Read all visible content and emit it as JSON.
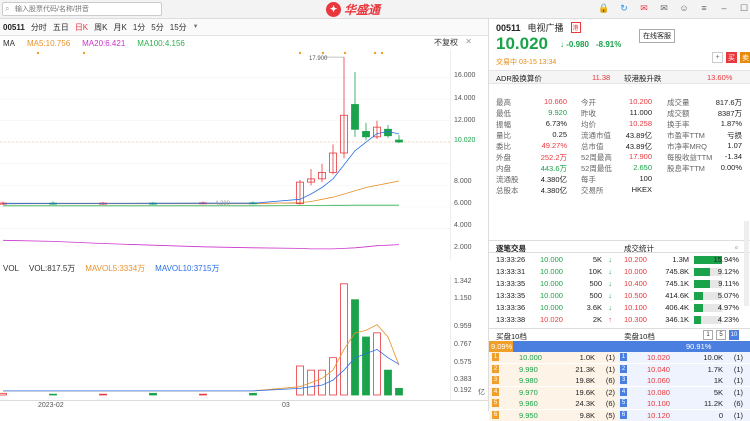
{
  "topbar": {
    "search_placeholder": "输入股票代码/名称/拼音",
    "logo_text": "华盛通",
    "icons": [
      "lock-icon",
      "refresh-icon",
      "message-icon",
      "mail-icon",
      "user-icon",
      "menu-icon",
      "minimize-icon",
      "maximize-icon",
      "close-icon"
    ]
  },
  "period_bar": {
    "code": "00511",
    "periods": [
      "分时",
      "五日",
      "日K",
      "周K",
      "月K",
      "1分",
      "5分",
      "15分"
    ],
    "active": "日K"
  },
  "ma_legend": {
    "label": "MA",
    "ma5": "MA5:10.756",
    "ma20": "MA20:6.421",
    "ma100": "MA100:4.156",
    "adjust": "不复权"
  },
  "price_axis": [
    "16.000",
    "14.000",
    "12.000",
    "10.020",
    "8.000",
    "6.000",
    "4.000",
    "2.000",
    "0.000"
  ],
  "high_marker": "17.900",
  "low_marker": "4.380",
  "vol_legend": {
    "label": "VOL",
    "vol": "VOL:817.5万",
    "mavol5": "MAVOL5:3334万",
    "mavol10": "MAVOL10:3715万"
  },
  "vol_axis": [
    "1.342",
    "1.150",
    "0.959",
    "0.767",
    "0.575",
    "0.383",
    "0.192"
  ],
  "vol_unit": "亿",
  "date_axis": [
    "2023-02",
    "03"
  ],
  "colors": {
    "up": "#e8383d",
    "down": "#1aa34a",
    "ma5": "#e8922c",
    "ma20": "#cc33cc",
    "ma100": "#2fae4e",
    "buy": "#f0a02a",
    "sell": "#4a7fe0"
  },
  "stock": {
    "code": "00511",
    "name": "电视广播",
    "price": "10.020",
    "change": "-0.980",
    "change_pct": "-8.91%",
    "service_button": "在线客服",
    "status": "交易中 03-15 13:34",
    "buy_btn": "买",
    "sell_btn": "卖",
    "more_btn": "更"
  },
  "adr": {
    "label": "ADR股换算价",
    "value": "11.38",
    "label2": "较港股升跌",
    "value2": "13.60%"
  },
  "quote": [
    [
      {
        "k": "最高",
        "v": "10.660",
        "c": "red"
      },
      {
        "k": "今开",
        "v": "10.200",
        "c": "red"
      },
      {
        "k": "成交量",
        "v": "817.6万",
        "c": "blk"
      }
    ],
    [
      {
        "k": "最低",
        "v": "9.920",
        "c": "grn"
      },
      {
        "k": "昨收",
        "v": "11.000",
        "c": "blk"
      },
      {
        "k": "成交额",
        "v": "8387万",
        "c": "blk"
      }
    ],
    [
      {
        "k": "振幅",
        "v": "6.73%",
        "c": "blk"
      },
      {
        "k": "均价",
        "v": "10.258",
        "c": "red"
      },
      {
        "k": "换手率",
        "v": "1.87%",
        "c": "blk"
      }
    ],
    [
      {
        "k": "量比",
        "v": "0.25",
        "c": "blk"
      },
      {
        "k": "流通市值",
        "v": "43.89亿",
        "c": "blk"
      },
      {
        "k": "市盈率TTM",
        "v": "亏损",
        "c": "blk"
      }
    ],
    [
      {
        "k": "委比",
        "v": "49.27%",
        "c": "red"
      },
      {
        "k": "总市值",
        "v": "43.89亿",
        "c": "blk"
      },
      {
        "k": "市净率MRQ",
        "v": "1.07",
        "c": "blk"
      }
    ],
    [
      {
        "k": "外盘",
        "v": "252.2万",
        "c": "red"
      },
      {
        "k": "52周最高",
        "v": "17.900",
        "c": "red"
      },
      {
        "k": "每股收益TTM",
        "v": "-1.34",
        "c": "blk"
      }
    ],
    [
      {
        "k": "内盘",
        "v": "443.6万",
        "c": "grn"
      },
      {
        "k": "52周最低",
        "v": "2.650",
        "c": "grn"
      },
      {
        "k": "股息率TTM",
        "v": "0.00%",
        "c": "blk"
      }
    ],
    [
      {
        "k": "流通股",
        "v": "4.380亿",
        "c": "blk"
      },
      {
        "k": "每手",
        "v": "100",
        "c": "blk"
      },
      {
        "k": "",
        "v": "",
        "c": "blk"
      }
    ],
    [
      {
        "k": "总股本",
        "v": "4.380亿",
        "c": "blk"
      },
      {
        "k": "交易所",
        "v": "HKEX",
        "c": "blk"
      },
      {
        "k": "",
        "v": "",
        "c": "blk"
      }
    ]
  ],
  "trades_tab": "逐笔交易",
  "stats_tab": "成交统计",
  "ticks": [
    {
      "t": "13:33:26",
      "p": "10.000",
      "v": "5K",
      "d": "down"
    },
    {
      "t": "13:33:31",
      "p": "10.000",
      "v": "10K",
      "d": "down"
    },
    {
      "t": "13:33:35",
      "p": "10.000",
      "v": "500",
      "d": "down"
    },
    {
      "t": "13:33:35",
      "p": "10.000",
      "v": "500",
      "d": "down"
    },
    {
      "t": "13:33:36",
      "p": "10.000",
      "v": "3.6K",
      "d": "down"
    },
    {
      "t": "13:33:38",
      "p": "10.020",
      "v": "2K",
      "d": "up"
    }
  ],
  "stats": [
    {
      "p": "10.200",
      "v": "1.3M",
      "pct": "15.94%",
      "f": 0.16
    },
    {
      "p": "10.000",
      "v": "745.8K",
      "pct": "9.12%",
      "f": 0.09
    },
    {
      "p": "10.400",
      "v": "745.1K",
      "pct": "9.11%",
      "f": 0.09
    },
    {
      "p": "10.500",
      "v": "414.6K",
      "pct": "5.07%",
      "f": 0.05
    },
    {
      "p": "10.100",
      "v": "406.4K",
      "pct": "4.97%",
      "f": 0.05
    },
    {
      "p": "10.300",
      "v": "346.1K",
      "pct": "4.23%",
      "f": 0.04
    }
  ],
  "orderbook": {
    "bid_tab": "买盘10档",
    "ask_tab": "卖盘10档",
    "pages": [
      "1",
      "5",
      "10"
    ],
    "bid_pct": "9.09%",
    "bid_frac": 0.0909,
    "ask_pct": "90.91%",
    "rows": [
      {
        "n": "1",
        "bp": "10.000",
        "bv": "1.0K",
        "bc": "(1)",
        "ap": "10.020",
        "av": "10.0K",
        "ac": "(1)"
      },
      {
        "n": "2",
        "bp": "9.990",
        "bv": "21.3K",
        "bc": "(1)",
        "ap": "10.040",
        "av": "1.7K",
        "ac": "(1)"
      },
      {
        "n": "3",
        "bp": "9.980",
        "bv": "19.8K",
        "bc": "(6)",
        "ap": "10.060",
        "av": "1K",
        "ac": "(1)"
      },
      {
        "n": "4",
        "bp": "9.970",
        "bv": "19.6K",
        "bc": "(2)",
        "ap": "10.080",
        "av": "5K",
        "ac": "(1)"
      },
      {
        "n": "5",
        "bp": "9.960",
        "bv": "24.3K",
        "bc": "(6)",
        "ap": "10.100",
        "av": "11.2K",
        "ac": "(6)"
      },
      {
        "n": "6",
        "bp": "9.950",
        "bv": "9.8K",
        "bc": "(5)",
        "ap": "10.120",
        "av": "0",
        "ac": "(1)"
      }
    ]
  },
  "chart_data": {
    "type": "candlestick",
    "ylim": [
      0,
      18
    ],
    "candles": [
      {
        "o": 4.3,
        "c": 4.35,
        "h": 4.5,
        "l": 4.2
      },
      {
        "o": 4.35,
        "c": 4.3,
        "h": 4.5,
        "l": 4.2
      },
      {
        "o": 4.3,
        "c": 4.35,
        "h": 4.45,
        "l": 4.2
      },
      {
        "o": 4.35,
        "c": 4.3,
        "h": 4.45,
        "l": 4.2
      },
      {
        "o": 4.3,
        "c": 4.38,
        "h": 4.5,
        "l": 4.25
      },
      {
        "o": 4.38,
        "c": 4.3,
        "h": 4.5,
        "l": 4.25
      },
      {
        "o": 4.3,
        "c": 6.3,
        "h": 6.5,
        "l": 4.2
      },
      {
        "o": 6.3,
        "c": 6.6,
        "h": 7.5,
        "l": 6.0
      },
      {
        "o": 6.6,
        "c": 7.2,
        "h": 8.0,
        "l": 6.3
      },
      {
        "o": 7.2,
        "c": 9.0,
        "h": 9.8,
        "l": 7.0
      },
      {
        "o": 9.0,
        "c": 12.5,
        "h": 17.9,
        "l": 8.5
      },
      {
        "o": 13.5,
        "c": 11.2,
        "h": 16.5,
        "l": 10.5
      },
      {
        "o": 11.0,
        "c": 10.5,
        "h": 11.8,
        "l": 10.2
      },
      {
        "o": 10.5,
        "c": 11.4,
        "h": 12.0,
        "l": 10.3
      },
      {
        "o": 11.2,
        "c": 10.6,
        "h": 11.6,
        "l": 10.4
      },
      {
        "o": 10.2,
        "c": 10.02,
        "h": 10.66,
        "l": 9.92
      }
    ],
    "ma5": [
      4.3,
      4.31,
      4.32,
      4.33,
      4.34,
      4.34,
      4.7,
      5.2,
      5.8,
      6.6,
      7.9,
      9.2,
      10.0,
      10.8,
      11.0,
      10.76
    ],
    "ma20": [
      0.9,
      0.8,
      0.6,
      0.45,
      0.3,
      0.2,
      0.15,
      0.1,
      0.1,
      0.1,
      0.15,
      0.2,
      0.3,
      0.4,
      0.45,
      0.5
    ],
    "mavolA": [
      4.3,
      4.3,
      4.3,
      4.3,
      4.3,
      4.3,
      4.4,
      4.5,
      4.7,
      4.9,
      5.2,
      5.5,
      5.8,
      6.0,
      6.2,
      6.4
    ],
    "ma100": [
      4.1,
      4.1,
      4.1,
      4.1,
      4.1,
      4.1,
      4.12,
      4.13,
      4.14,
      4.15,
      4.15,
      4.16,
      4.16,
      4.16,
      4.16,
      4.16
    ],
    "volume": [
      0.02,
      0.01,
      0.01,
      0.02,
      0.01,
      0.02,
      0.35,
      0.3,
      0.3,
      0.45,
      1.342,
      1.15,
      0.7,
      0.75,
      0.3,
      0.08
    ],
    "vol_up": [
      true,
      false,
      true,
      false,
      true,
      false,
      true,
      true,
      true,
      true,
      true,
      false,
      false,
      true,
      false,
      false
    ],
    "mavol5": [
      0.05,
      0.05,
      0.05,
      0.05,
      0.05,
      0.05,
      0.1,
      0.15,
      0.2,
      0.3,
      0.55,
      0.75,
      0.78,
      0.85,
      0.7,
      0.36
    ],
    "mavol10": [
      0.05,
      0.05,
      0.05,
      0.05,
      0.05,
      0.05,
      0.08,
      0.1,
      0.12,
      0.18,
      0.3,
      0.45,
      0.5,
      0.55,
      0.45,
      0.37
    ]
  }
}
